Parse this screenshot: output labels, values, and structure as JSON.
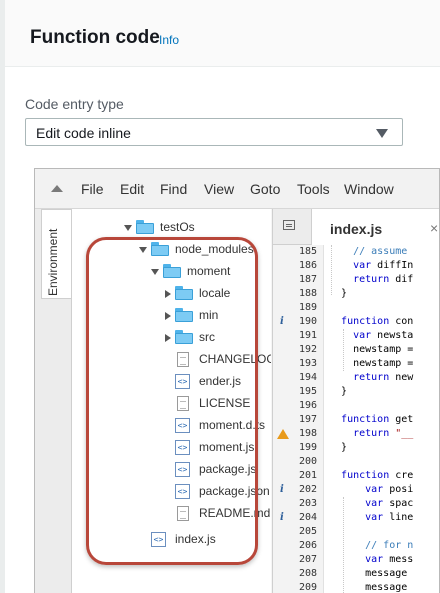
{
  "header": {
    "title": "Function code",
    "info_link": "Info"
  },
  "code_entry": {
    "label": "Code entry type",
    "selected": "Edit code inline"
  },
  "ide": {
    "menu": [
      "File",
      "Edit",
      "Find",
      "View",
      "Goto",
      "Tools",
      "Window"
    ],
    "environment_tab": "Environment",
    "tree": {
      "root": "testOs",
      "node_modules": "node_modules",
      "moment": "moment",
      "folders": [
        "locale",
        "min",
        "src"
      ],
      "files": [
        "CHANGELOG.md",
        "ender.js",
        "LICENSE",
        "moment.d.ts",
        "moment.js",
        "package.js",
        "package.json",
        "README.md"
      ],
      "index": "index.js"
    },
    "editor": {
      "tab_label": "index.js",
      "tab_close": "×",
      "line_numbers": [
        "185",
        "186",
        "187",
        "188",
        "189",
        "190",
        "191",
        "192",
        "193",
        "194",
        "195",
        "196",
        "197",
        "198",
        "199",
        "200",
        "201",
        "202",
        "203",
        "204",
        "205",
        "206",
        "207",
        "208",
        "209"
      ],
      "code_lines": [
        "    // assume",
        "    var diffIn",
        "    return dif",
        "  }",
        "",
        "  function con",
        "    var newsta",
        "    newstamp =",
        "    newstamp =",
        "    return new",
        "  }",
        "",
        "  function get",
        "    return \"__",
        "  }",
        "",
        "  function cre",
        "      var posi",
        "      var spac",
        "      var line",
        "",
        "      // for n",
        "      var mess",
        "      message",
        "      message"
      ],
      "info_marker": "i"
    }
  }
}
